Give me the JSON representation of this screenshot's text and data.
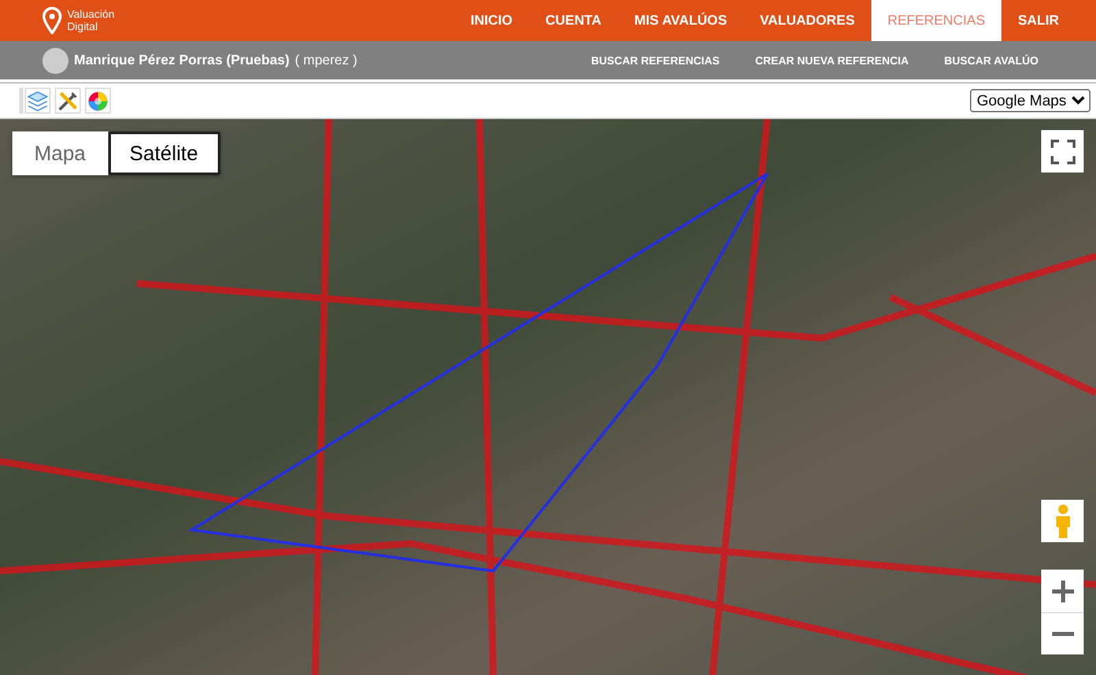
{
  "brand": {
    "name": "Valuación Digital"
  },
  "nav": [
    {
      "label": "INICIO",
      "selected": false
    },
    {
      "label": "CUENTA",
      "selected": false
    },
    {
      "label": "MIS AVALÚOS",
      "selected": false
    },
    {
      "label": "VALUADORES",
      "selected": false
    },
    {
      "label": "REFERENCIAS",
      "selected": true
    },
    {
      "label": "SALIR",
      "selected": false
    }
  ],
  "user": {
    "name": "Manrique Pérez Porras (Pruebas)",
    "username": "( mperez )"
  },
  "subnav": [
    "BUSCAR REFERENCIAS",
    "CREAR NUEVA REFERENCIA",
    "BUSCAR AVALÚO"
  ],
  "toolbar": [
    {
      "kind": "layers"
    },
    {
      "kind": "tools"
    },
    {
      "kind": "colors"
    }
  ],
  "map_provider": {
    "value": "Google Maps"
  },
  "map_type_tabs": [
    {
      "label": "Mapa",
      "selected": false
    },
    {
      "label": "Satélite",
      "selected": true
    }
  ]
}
